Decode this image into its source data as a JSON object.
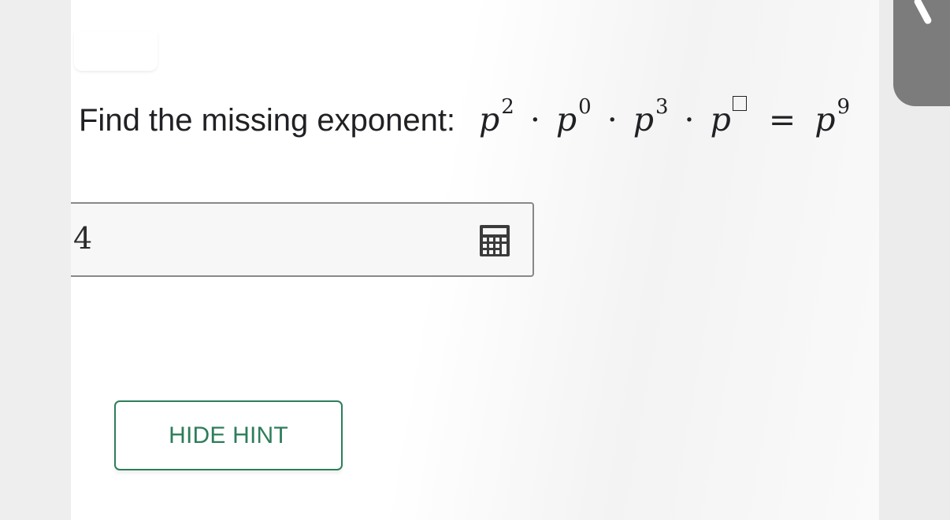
{
  "question": {
    "prompt": "Find the missing exponent:",
    "expression": {
      "variable": "p",
      "exponents": [
        "2",
        "0",
        "3"
      ],
      "operator": "·",
      "equals": "=",
      "result_exponent": "9"
    }
  },
  "answer": {
    "value": "4"
  },
  "hint_button": {
    "label": "HIDE HINT"
  },
  "icons": {
    "calculator": "calculator-icon",
    "missing_exponent": "blank-box-icon"
  },
  "colors": {
    "accent_green": "#2e7d5b",
    "text": "#202124",
    "overlay_gray": "#7c7c7c"
  }
}
